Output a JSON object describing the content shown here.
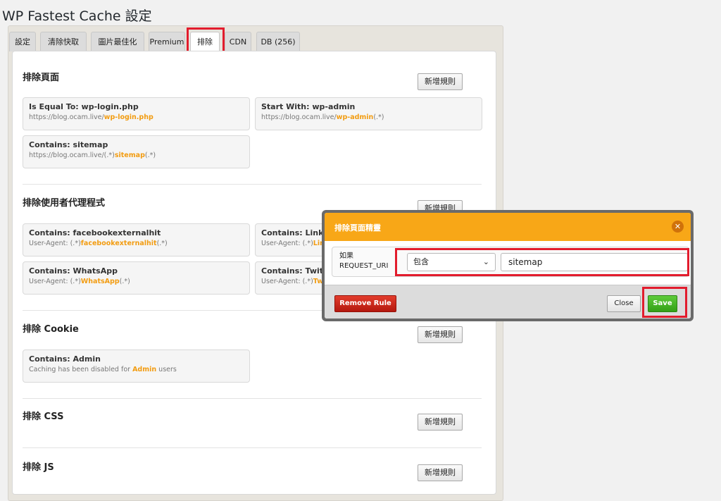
{
  "page": {
    "title": "WP Fastest Cache 設定"
  },
  "tabs": [
    "設定",
    "清除快取",
    "圖片最佳化",
    "Premium",
    "排除",
    "CDN",
    "DB (256)"
  ],
  "add_rule_label": "新增規則",
  "sections": {
    "pages": {
      "title": "排除頁面",
      "rules": [
        {
          "head": "Is Equal To: wp-login.php",
          "prefix": "https://blog.ocam.live/",
          "hl": "wp-login.php",
          "suffix": ""
        },
        {
          "head": "Start With: wp-admin",
          "prefix": "https://blog.ocam.live/",
          "hl": "wp-admin",
          "suffix": "(.*)"
        },
        {
          "head": "Contains: sitemap",
          "prefix": "https://blog.ocam.live/(.*)",
          "hl": "sitemap",
          "suffix": "(.*)"
        }
      ]
    },
    "useragent": {
      "title": "排除使用者代理程式",
      "rules": [
        {
          "head": "Contains: facebookexternalhit",
          "prefix": "User-Agent: (.*)",
          "hl": "facebookexternalhit",
          "suffix": "(.*)"
        },
        {
          "head": "Contains: LinkedIn",
          "prefix": "User-Agent: (.*)",
          "hl": "LinkedIn",
          "suffix": "(.*)"
        },
        {
          "head": "Contains: WhatsApp",
          "prefix": "User-Agent: (.*)",
          "hl": "WhatsApp",
          "suffix": "(.*)"
        },
        {
          "head": "Contains: Twitterbot",
          "prefix": "User-Agent: (.*)",
          "hl": "Twitterbot",
          "suffix": "(.*)"
        }
      ]
    },
    "cookie": {
      "title": "排除 Cookie",
      "rules": [
        {
          "head": "Contains: Admin",
          "prefix": "Caching has been disabled for ",
          "hl": "Admin",
          "suffix": " users"
        }
      ]
    },
    "css": {
      "title": "排除 CSS"
    },
    "js": {
      "title": "排除 JS"
    }
  },
  "modal": {
    "title": "排除頁面精靈",
    "condition_label_1": "如果",
    "condition_label_2": "REQUEST_URI",
    "select_value": "包含",
    "text_value": "sitemap",
    "remove_label": "Remove Rule",
    "close_label": "Close",
    "save_label": "Save"
  },
  "colors": {
    "accent": "#f8a717",
    "highlight": "#f29c11",
    "annotation": "#e21c2d",
    "save": "#3ba91f",
    "remove": "#c8261b"
  }
}
